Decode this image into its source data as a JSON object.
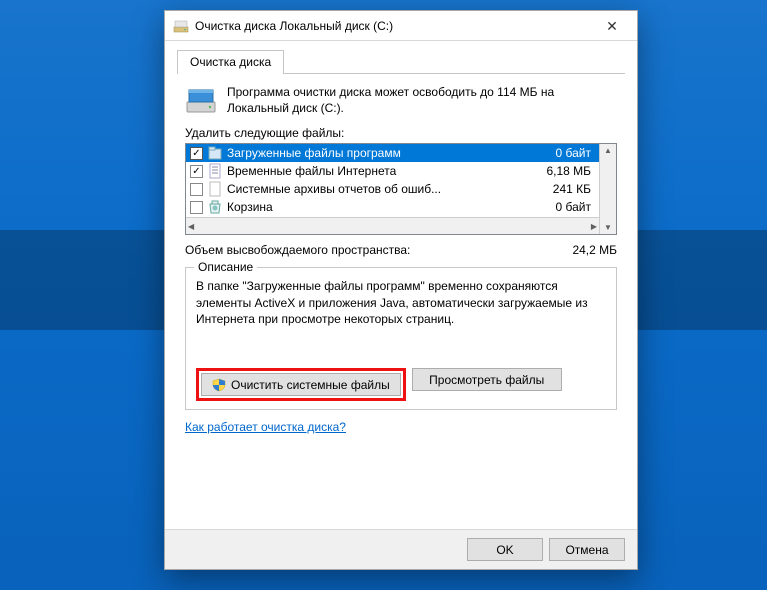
{
  "window": {
    "title": "Очистка диска Локальный диск (C:)"
  },
  "tab": {
    "label": "Очистка диска"
  },
  "intro": "Программа очистки диска может освободить до 114 МБ на Локальный диск (C:).",
  "list_label": "Удалить следующие файлы:",
  "items": [
    {
      "name": "Загруженные файлы программ",
      "size": "0 байт",
      "checked": true,
      "selected": true
    },
    {
      "name": "Временные файлы Интернета",
      "size": "6,18 МБ",
      "checked": true,
      "selected": false
    },
    {
      "name": "Системные архивы отчетов об ошиб...",
      "size": "241 КБ",
      "checked": false,
      "selected": false
    },
    {
      "name": "Корзина",
      "size": "0 байт",
      "checked": false,
      "selected": false
    }
  ],
  "total": {
    "label": "Объем высвобождаемого пространства:",
    "value": "24,2 МБ"
  },
  "description": {
    "legend": "Описание",
    "text": "В папке \"Загруженные файлы программ\" временно сохраняются элементы ActiveX и приложения Java, автоматически загружаемые из Интернета при просмотре некоторых страниц."
  },
  "buttons": {
    "clean_system": "Очистить системные файлы",
    "view_files": "Просмотреть файлы",
    "ok": "OK",
    "cancel": "Отмена"
  },
  "link": "Как работает очистка диска?"
}
